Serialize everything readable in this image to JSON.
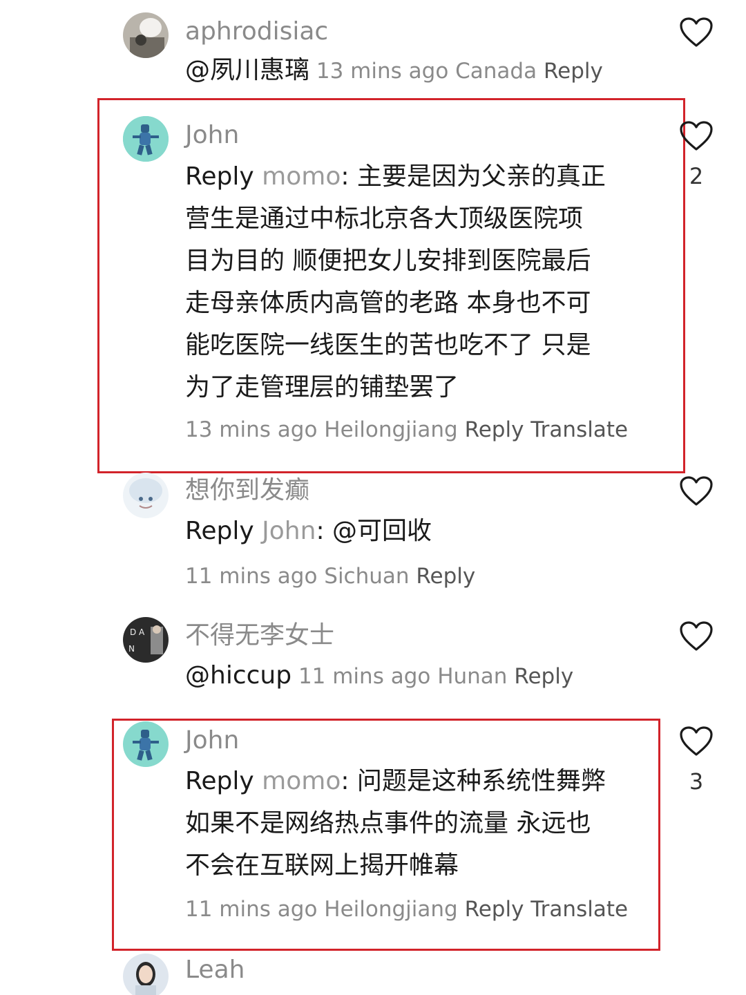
{
  "comments": [
    {
      "username": "aphrodisiac",
      "mention": "@夙川惠璃",
      "time": "13 mins ago",
      "location": "Canada",
      "reply": "Reply",
      "likes": ""
    },
    {
      "username": "John",
      "reply_word": "Reply",
      "reply_target": "momo",
      "text_lines": [
        ": 主要是因为父亲的真正",
        "营生是通过中标北京各大顶级医院项",
        "目为目的 顺便把女儿安排到医院最后",
        "走母亲体质内高管的老路 本身也不可",
        "能吃医院一线医生的苦也吃不了 只是",
        "为了走管理层的铺垫罢了"
      ],
      "time": "13 mins ago",
      "location": "Heilongjiang",
      "reply": "Reply",
      "translate": "Translate",
      "likes": "2"
    },
    {
      "username": "想你到发癫",
      "reply_word": "Reply",
      "reply_target": "John",
      "text": ": @可回收",
      "time": "11 mins ago",
      "location": "Sichuan",
      "reply": "Reply",
      "likes": ""
    },
    {
      "username": "不得无李女士",
      "mention": "@hiccup",
      "time": "11 mins ago",
      "location": "Hunan",
      "reply": "Reply",
      "likes": ""
    },
    {
      "username": "John",
      "reply_word": "Reply",
      "reply_target": "momo",
      "text_lines": [
        ": 问题是这种系统性舞弊",
        "如果不是网络热点事件的流量 永远也",
        "不会在互联网上揭开帷幕"
      ],
      "time": "11 mins ago",
      "location": "Heilongjiang",
      "reply": "Reply",
      "translate": "Translate",
      "likes": "3"
    },
    {
      "username": "Leah"
    }
  ],
  "colors": {
    "highlight": "#d2232a",
    "username": "#8a8a8a",
    "text": "#1a1a1a"
  },
  "icons": [
    "heart-outline-icon"
  ]
}
